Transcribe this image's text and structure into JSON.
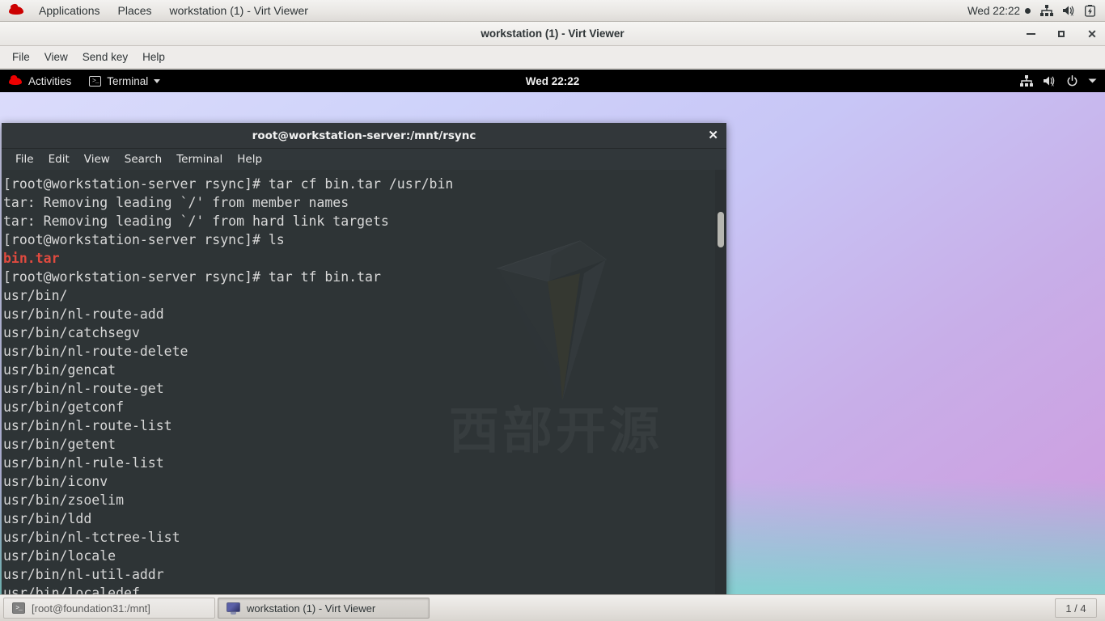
{
  "host_panel": {
    "logo_icon": "redhat-logo-icon",
    "menus": [
      "Applications",
      "Places"
    ],
    "window_label": "workstation (1) - Virt Viewer",
    "clock": "Wed 22:22",
    "tray_icons": [
      "network-icon",
      "volume-muted-icon",
      "battery-icon"
    ]
  },
  "virt_viewer": {
    "title": "workstation (1) - Virt Viewer",
    "menus": [
      "File",
      "View",
      "Send key",
      "Help"
    ],
    "window_buttons": [
      "minimize-button",
      "maximize-button",
      "close-button"
    ]
  },
  "guest_topbar": {
    "activities": "Activities",
    "app_name": "Terminal",
    "clock": "Wed 22:22",
    "tray_icons": [
      "network-icon",
      "volume-muted-icon",
      "power-icon",
      "chevron-down-icon"
    ]
  },
  "terminal": {
    "title": "root@workstation-server:/mnt/rsync",
    "close_label": "✕",
    "menus": [
      "File",
      "Edit",
      "View",
      "Search",
      "Terminal",
      "Help"
    ],
    "watermark_text": "西部开源",
    "prompt": "[root@workstation-server rsync]#",
    "lines": [
      {
        "type": "prompt",
        "prompt": "[root@workstation-server rsync]# ",
        "command": "tar cf bin.tar /usr/bin"
      },
      {
        "type": "out",
        "text": "tar: Removing leading `/' from member names"
      },
      {
        "type": "out",
        "text": "tar: Removing leading `/' from hard link targets"
      },
      {
        "type": "prompt",
        "prompt": "[root@workstation-server rsync]# ",
        "command": "ls"
      },
      {
        "type": "red",
        "text": "bin.tar"
      },
      {
        "type": "prompt",
        "prompt": "[root@workstation-server rsync]# ",
        "command": "tar tf bin.tar"
      },
      {
        "type": "out",
        "text": "usr/bin/"
      },
      {
        "type": "out",
        "text": "usr/bin/nl-route-add"
      },
      {
        "type": "out",
        "text": "usr/bin/catchsegv"
      },
      {
        "type": "out",
        "text": "usr/bin/nl-route-delete"
      },
      {
        "type": "out",
        "text": "usr/bin/gencat"
      },
      {
        "type": "out",
        "text": "usr/bin/nl-route-get"
      },
      {
        "type": "out",
        "text": "usr/bin/getconf"
      },
      {
        "type": "out",
        "text": "usr/bin/nl-route-list"
      },
      {
        "type": "out",
        "text": "usr/bin/getent"
      },
      {
        "type": "out",
        "text": "usr/bin/nl-rule-list"
      },
      {
        "type": "out",
        "text": "usr/bin/iconv"
      },
      {
        "type": "out",
        "text": "usr/bin/zsoelim"
      },
      {
        "type": "out",
        "text": "usr/bin/ldd"
      },
      {
        "type": "out",
        "text": "usr/bin/nl-tctree-list"
      },
      {
        "type": "out",
        "text": "usr/bin/locale"
      },
      {
        "type": "out",
        "text": "usr/bin/nl-util-addr"
      },
      {
        "type": "out",
        "text": "usr/bin/localedef"
      }
    ]
  },
  "taskbar": {
    "items": [
      {
        "label": "[root@foundation31:/mnt]",
        "icon": "terminal-icon",
        "active": false
      },
      {
        "label": "workstation (1) - Virt Viewer",
        "icon": "monitor-icon",
        "active": true
      }
    ],
    "pager": "1 / 4"
  },
  "colors": {
    "terminal_bg": "#2e3436",
    "terminal_fg": "#d8d8d8",
    "terminal_red": "#e04a3f",
    "redhat_red": "#cc0000",
    "desktop_gradient_start": "#dcdcfb",
    "desktop_gradient_end": "#cf9ade"
  }
}
